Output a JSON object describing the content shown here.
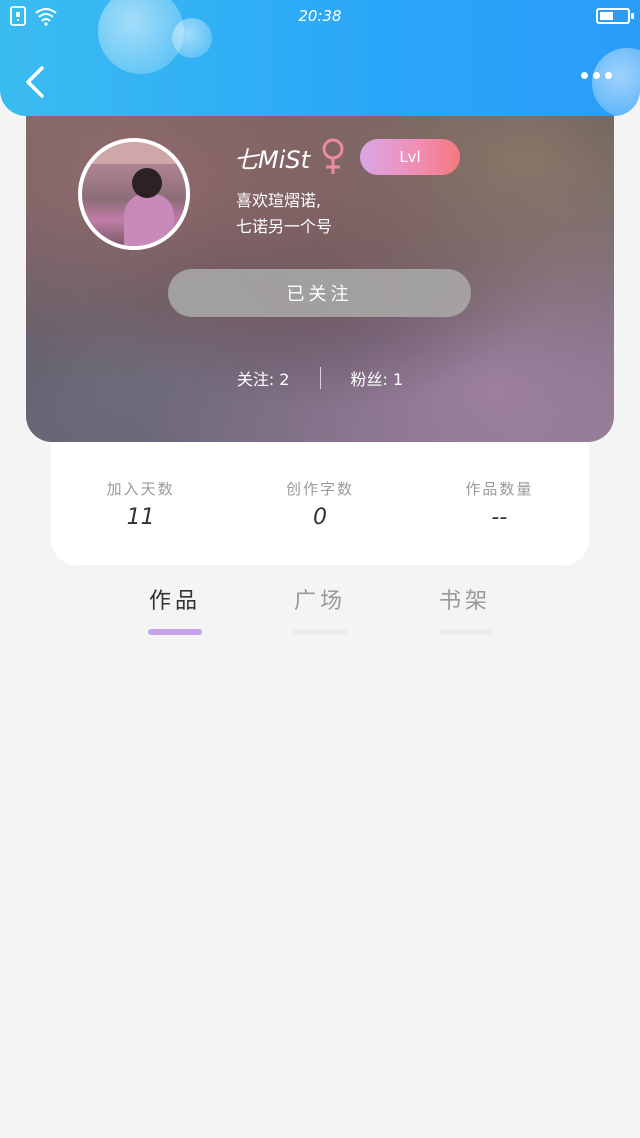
{
  "status_bar": {
    "time": "20:38",
    "battery_level": 0.5
  },
  "header": {
    "back_icon": "chevron-left-icon",
    "more_icon": "more-horizontal-icon"
  },
  "profile": {
    "username": "七MiSt",
    "gender_icon": "female-symbol-icon",
    "level": "Lvl",
    "bio_line1": "喜欢瑄熠诺,",
    "bio_line2": "七诺另一个号",
    "follow_button": "已关注",
    "following_text": "关注: 2",
    "followers_text": "粉丝: 1"
  },
  "stats": [
    {
      "label": "加入天数",
      "value": "11"
    },
    {
      "label": "创作字数",
      "value": "0"
    },
    {
      "label": "作品数量",
      "value": "--"
    }
  ],
  "tabs": [
    {
      "label": "作品",
      "active": true
    },
    {
      "label": "广场",
      "active": false
    },
    {
      "label": "书架",
      "active": false
    }
  ],
  "colors": {
    "header_gradient_start": "#3bbcf0",
    "header_gradient_end": "#2b9cf8",
    "level_badge_start": "#d9a7e6",
    "level_badge_end": "#f3797e",
    "gender_icon": "#f08aa4",
    "active_tab_indicator": "#c6a5ea"
  }
}
